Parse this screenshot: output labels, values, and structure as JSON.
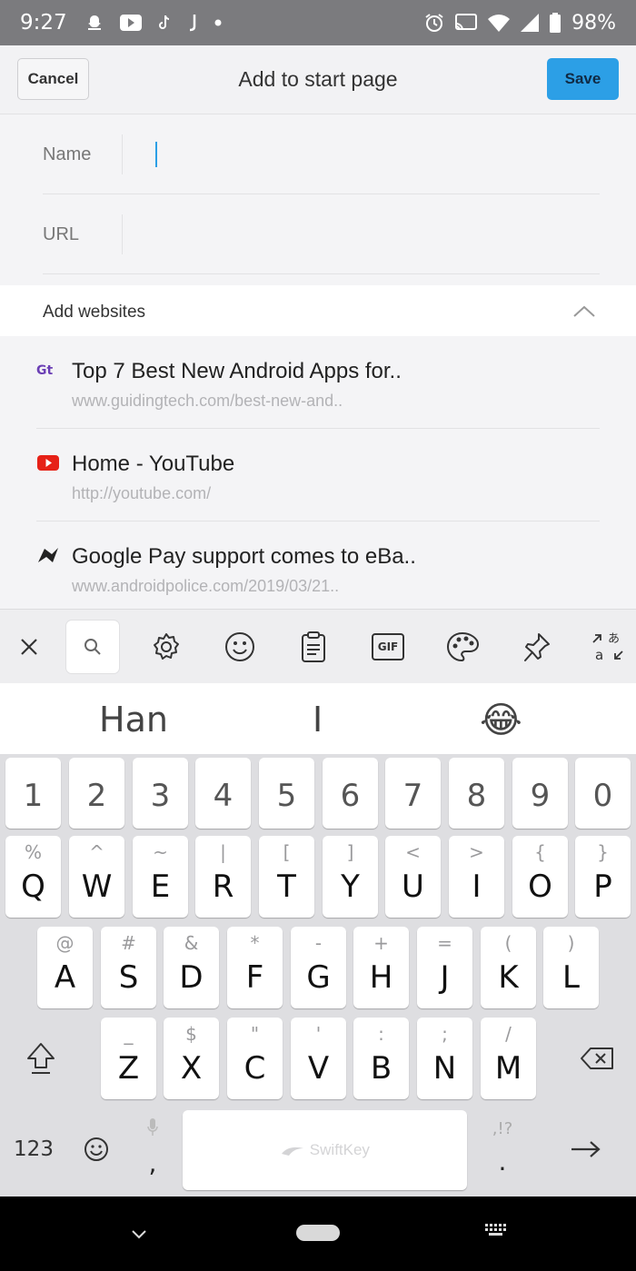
{
  "status_bar": {
    "time": "9:27",
    "battery": "98%",
    "left_icons": [
      "snapchat-icon",
      "youtube-icon",
      "tiktok-icon",
      "j-icon",
      "dot-icon"
    ],
    "right_icons": [
      "alarm-icon",
      "cast-icon",
      "wifi-icon",
      "signal-icon",
      "battery-icon"
    ]
  },
  "header": {
    "cancel_label": "Cancel",
    "title": "Add to start page",
    "save_label": "Save",
    "save_color": "#2c9fe6"
  },
  "form": {
    "name_label": "Name",
    "name_value": "",
    "url_label": "URL",
    "url_value": ""
  },
  "websites": {
    "section_title": "Add websites",
    "items": [
      {
        "title": "Top 7 Best New Android Apps for..",
        "url": "www.guidingtech.com/best-new-and..",
        "icon": "guidingtech-icon"
      },
      {
        "title": "Home - YouTube",
        "url": "http://youtube.com/",
        "icon": "youtube-icon"
      },
      {
        "title": "Google Pay support comes to eBa..",
        "url": "www.androidpolice.com/2019/03/21..",
        "icon": "androidpolice-icon"
      }
    ]
  },
  "keyboard_toolbar": {
    "gif_label": "GIF",
    "items": [
      "close-icon",
      "search-icon",
      "settings-icon",
      "emoji-icon",
      "clipboard-icon",
      "gif-icon",
      "themes-icon",
      "pin-icon",
      "translate-icon"
    ]
  },
  "suggestions": [
    "Han",
    "I",
    "😂"
  ],
  "keyboard": {
    "numbers": [
      "1",
      "2",
      "3",
      "4",
      "5",
      "6",
      "7",
      "8",
      "9",
      "0"
    ],
    "row1": [
      {
        "main": "Q",
        "sub": "%"
      },
      {
        "main": "W",
        "sub": "^"
      },
      {
        "main": "E",
        "sub": "~"
      },
      {
        "main": "R",
        "sub": "|"
      },
      {
        "main": "T",
        "sub": "["
      },
      {
        "main": "Y",
        "sub": "]"
      },
      {
        "main": "U",
        "sub": "<"
      },
      {
        "main": "I",
        "sub": ">"
      },
      {
        "main": "O",
        "sub": "{"
      },
      {
        "main": "P",
        "sub": "}"
      }
    ],
    "row2": [
      {
        "main": "A",
        "sub": "@"
      },
      {
        "main": "S",
        "sub": "#"
      },
      {
        "main": "D",
        "sub": "&"
      },
      {
        "main": "F",
        "sub": "*"
      },
      {
        "main": "G",
        "sub": "-"
      },
      {
        "main": "H",
        "sub": "+"
      },
      {
        "main": "J",
        "sub": "="
      },
      {
        "main": "K",
        "sub": "("
      },
      {
        "main": "L",
        "sub": ")"
      }
    ],
    "row3": [
      {
        "main": "Z",
        "sub": "_"
      },
      {
        "main": "X",
        "sub": "$"
      },
      {
        "main": "C",
        "sub": "\""
      },
      {
        "main": "V",
        "sub": "'"
      },
      {
        "main": "B",
        "sub": ":"
      },
      {
        "main": "N",
        "sub": ";"
      },
      {
        "main": "M",
        "sub": "/"
      }
    ],
    "numbers_toggle": "123",
    "comma": ",",
    "space_brand": "SwiftKey",
    "period": ".",
    "period_sub": ",!?"
  }
}
